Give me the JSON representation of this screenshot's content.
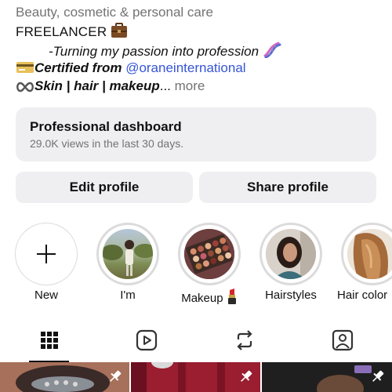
{
  "bio": {
    "category": "Beauty, cosmetic & personal care",
    "line2": "FREELANCER",
    "line3": "-Turning my passion into profession",
    "line4_prefix": "Certified from ",
    "line4_link": "@oraneinternational",
    "line5_text": "Skin | hair | makeup",
    "line5_ellipsis": "...",
    "more": " more",
    "icons": [
      "briefcase-icon",
      "dna-icon",
      "credit-card-icon",
      "infinity-icon"
    ]
  },
  "dashboard": {
    "title": "Professional dashboard",
    "subtitle": "29.0K views in the last 30 days."
  },
  "buttons": {
    "edit": "Edit profile",
    "share": "Share profile"
  },
  "highlights": [
    {
      "label": "New",
      "icon": "plus-icon"
    },
    {
      "label": "I'm"
    },
    {
      "label": "Makeup",
      "icon": "lipstick-icon"
    },
    {
      "label": "Hairstyles"
    },
    {
      "label": "Hair color"
    }
  ],
  "tabs": [
    "grid-icon",
    "reels-icon",
    "reposts-icon",
    "tagged-icon"
  ],
  "colors": {
    "link": "#3555d6",
    "secondary": "#737373",
    "card": "#efeff1"
  }
}
